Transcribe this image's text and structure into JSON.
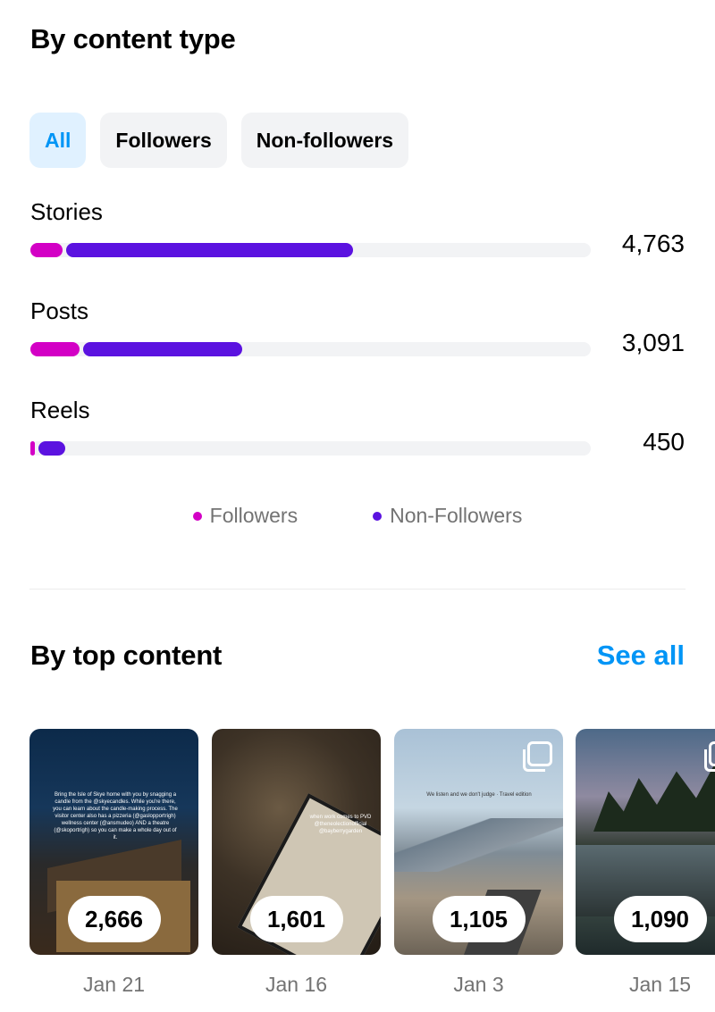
{
  "content_type_section": {
    "title": "By content type",
    "filters": [
      {
        "label": "All",
        "active": true
      },
      {
        "label": "Followers",
        "active": false
      },
      {
        "label": "Non-followers",
        "active": false
      }
    ],
    "metrics": [
      {
        "label": "Stories",
        "value": "4,763",
        "followers_fraction": 0.058,
        "non_followers_fraction": 0.512
      },
      {
        "label": "Posts",
        "value": "3,091",
        "followers_fraction": 0.087,
        "non_followers_fraction": 0.284
      },
      {
        "label": "Reels",
        "value": "450",
        "followers_fraction": 0.005,
        "non_followers_fraction": 0.048
      }
    ],
    "legend": {
      "followers": {
        "label": "Followers",
        "color": "#d300c5"
      },
      "non_followers": {
        "label": "Non-Followers",
        "color": "#5b12e0"
      }
    }
  },
  "top_content_section": {
    "title": "By top content",
    "see_all": "See all",
    "items": [
      {
        "count": "2,666",
        "date": "Jan 21",
        "overlay_text": "Bring the Isle of Skye home with you by snagging a candle from the @skyecandles. While you're there, you can learn about the candle-making process. The visitor center also has a pizzeria (@gaslopportrigh) wellness center (@ansmudeo) AND a theatre (@skoportrigh) so you can make a whole day out of it."
      },
      {
        "count": "1,601",
        "date": "Jan 16",
        "overlay_text": "when work comes to PVD @theneolectionofficial @bayberrygarden"
      },
      {
        "count": "1,105",
        "date": "Jan 3",
        "overlay_text": "We listen and we don't judge · Travel edition"
      },
      {
        "count": "1,090",
        "date": "Jan 15",
        "overlay_text": ""
      }
    ]
  },
  "colors": {
    "accent": "#0095f6",
    "track": "#f2f3f5",
    "chip": "#f2f3f5",
    "chip_active_bg": "#e0f1ff"
  }
}
